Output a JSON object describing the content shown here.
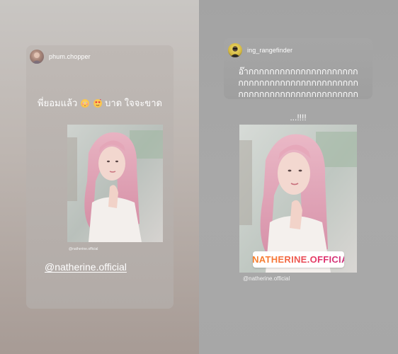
{
  "left_story": {
    "username": "phum.chopper",
    "message_before": "พี่ยอมแล้ว",
    "emoji_1": "flushed-face",
    "emoji_2": "heart-eyes-face",
    "message_after": "บาด ใจจะขาด",
    "photo_credit": "@natherine.official",
    "mention": "@natherine.official"
  },
  "right_story": {
    "username": "ing_rangefinder",
    "message_lines": [
      "อ๊ากกกกกกกกกกกกกกกกกกกกก",
      "กกกกกกกกกกกกกกกกกกกกกกก",
      "กกกกกกกกกกกกกกกกกกกกกกก"
    ],
    "exclaim": "...!!!!",
    "mention_sticker": "@NATHERINE.OFFICIAL",
    "photo_credit": "@natherine.official"
  },
  "colors": {
    "left_background": "#bdb5b0",
    "right_background": "#a9a9a9",
    "text": "#ffffff",
    "sticker_gradient": [
      "#f58529",
      "#e1306c",
      "#c13584"
    ]
  }
}
